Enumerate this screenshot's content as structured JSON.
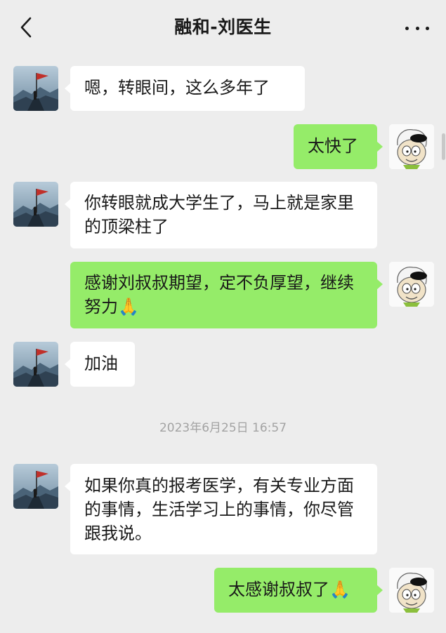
{
  "header": {
    "back_icon": "chevron-left-icon",
    "title": "融和-刘医生",
    "more_icon": "more-dots-icon"
  },
  "messages": [
    {
      "side": "in",
      "text": "嗯，转眼间，这么多年了"
    },
    {
      "side": "out",
      "text": "太快了"
    },
    {
      "side": "in",
      "text": "你转眼就成大学生了，马上就是家里的顶梁柱了"
    },
    {
      "side": "out",
      "text": "感谢刘叔叔期望，定不负厚望，继续努力🙏"
    },
    {
      "side": "in",
      "text": "加油"
    },
    {
      "side": "in",
      "text": "如果你真的报考医学，有关专业方面的事情，生活学习上的事情，你尽管跟我说。"
    },
    {
      "side": "out",
      "text": "太感谢叔叔了🙏"
    }
  ],
  "timestamp": "2023年6月25日 16:57",
  "colors": {
    "background": "#ededed",
    "incoming_bubble": "#ffffff",
    "outgoing_bubble": "#95ec69"
  }
}
